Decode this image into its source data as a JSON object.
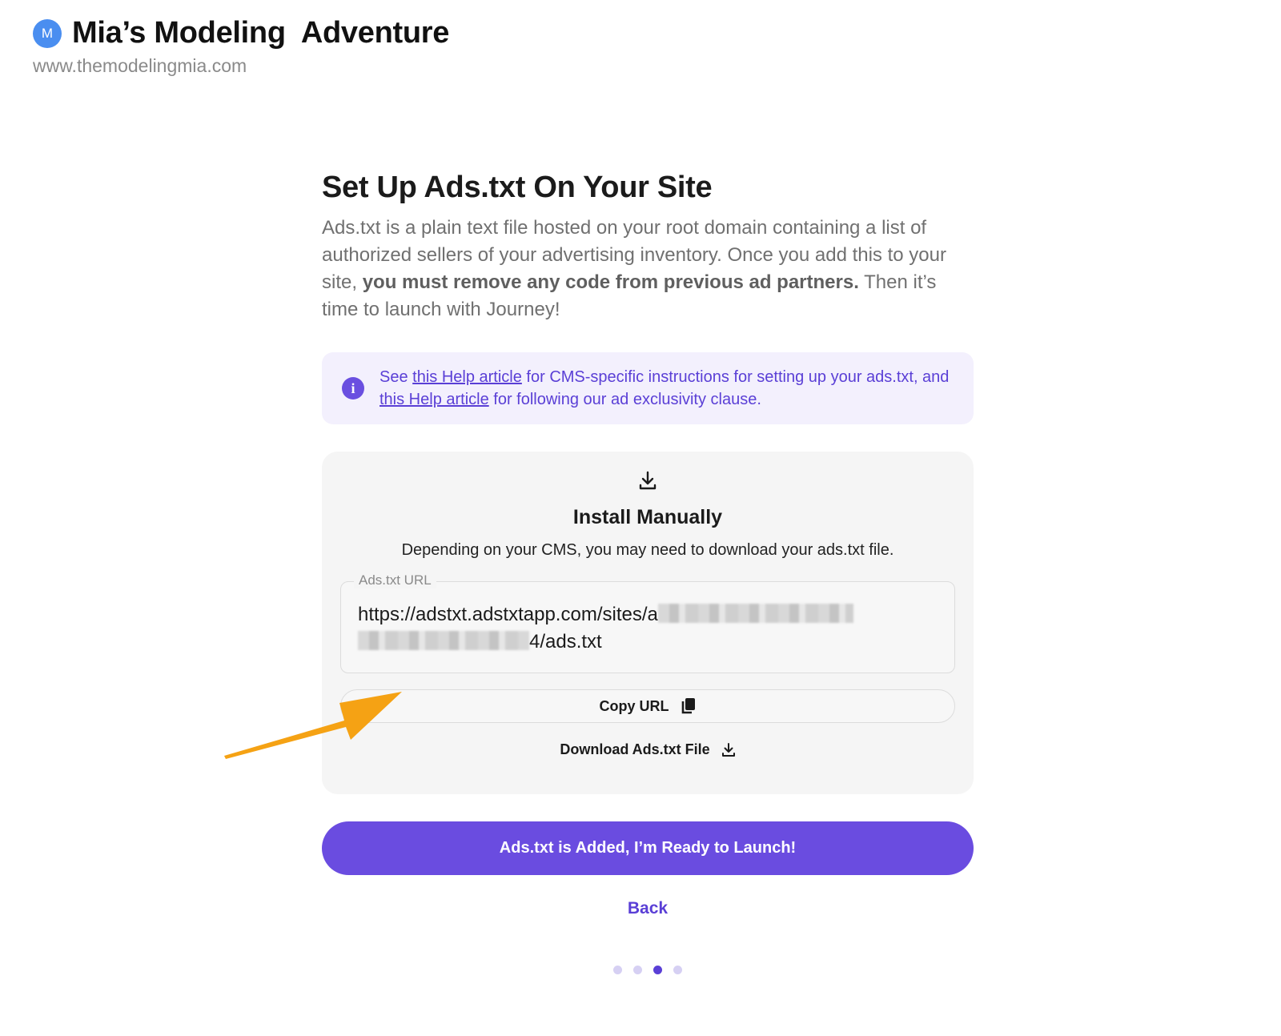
{
  "header": {
    "avatar_letter": "M",
    "site_title": "Mia’s Modeling  Adventure",
    "site_url": "www.themodelingmia.com"
  },
  "main": {
    "title": "Set Up Ads.txt On Your Site",
    "intro_part1": "Ads.txt is a plain text file hosted on your root domain containing a list of authorized sellers of your advertising inventory. Once you add this to your site, ",
    "intro_bold": "you must remove any code from previous ad partners.",
    "intro_part2": " Then it’s time to launch with Journey!"
  },
  "info": {
    "icon": "info-icon",
    "text_see": "See ",
    "link1": "this Help article",
    "text_mid": " for CMS-specific instructions for setting up your ads.txt, and ",
    "link2": "this Help article",
    "text_end": " for following our ad exclusivity clause."
  },
  "install": {
    "icon": "download-icon",
    "title": "Install Manually",
    "description": "Depending on your CMS, you may need to download your ads.txt file.",
    "field_label": "Ads.txt URL",
    "url_prefix": "https://adstxt.adstxtapp.com/sites/a",
    "url_suffix": "4/ads.txt",
    "copy_label": "Copy URL",
    "copy_icon": "copy-icon",
    "download_label": "Download Ads.txt File",
    "download_icon": "download-icon"
  },
  "actions": {
    "launch_label": "Ads.txt is Added, I’m Ready to Launch!",
    "back_label": "Back"
  },
  "pager": {
    "total_steps": 4,
    "current_step": 3
  },
  "colors": {
    "accent": "#6a4ce0",
    "info_bg": "#f3f0fd",
    "annotation_arrow": "#f5a214",
    "avatar": "#4a8ef0"
  }
}
